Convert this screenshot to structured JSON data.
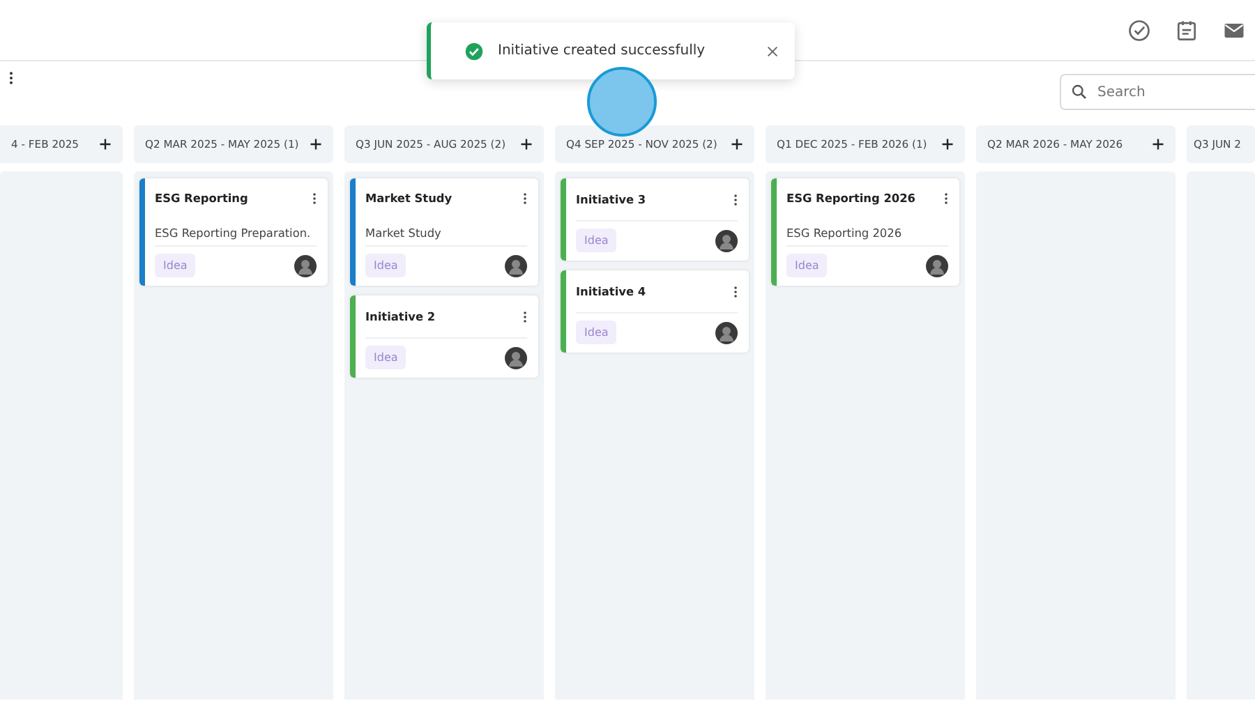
{
  "toast": {
    "message": "Initiative created successfully"
  },
  "search": {
    "placeholder": "Search"
  },
  "columns": [
    {
      "title": "4 - FEB 2025",
      "add": true
    },
    {
      "title": "Q2 MAR 2025 - MAY 2025 (1)",
      "add": true,
      "cards": [
        {
          "title": "ESG Reporting",
          "description": "ESG Reporting Preparation.",
          "tag": "Idea",
          "color": "#1a7fc8"
        }
      ]
    },
    {
      "title": "Q3 JUN 2025 - AUG 2025 (2)",
      "add": true,
      "cards": [
        {
          "title": "Market Study",
          "description": "Market Study",
          "tag": "Idea",
          "color": "#1a7fc8"
        },
        {
          "title": "Initiative 2",
          "tag": "Idea",
          "color": "#4caf50"
        }
      ]
    },
    {
      "title": "Q4 SEP 2025 - NOV 2025 (2)",
      "add": true,
      "cards": [
        {
          "title": "Initiative 3",
          "tag": "Idea",
          "color": "#4caf50"
        },
        {
          "title": "Initiative 4",
          "tag": "Idea",
          "color": "#4caf50"
        }
      ]
    },
    {
      "title": "Q1 DEC 2025 - FEB 2026 (1)",
      "add": true,
      "cards": [
        {
          "title": "ESG Reporting 2026",
          "description": "ESG Reporting 2026",
          "tag": "Idea",
          "color": "#4caf50"
        }
      ]
    },
    {
      "title": "Q2 MAR 2026 - MAY 2026",
      "add": true
    },
    {
      "title": "Q3 JUN 2",
      "add": false
    }
  ]
}
